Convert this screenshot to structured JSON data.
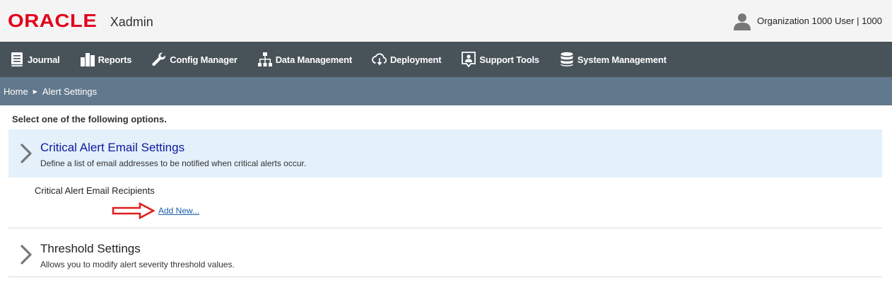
{
  "header": {
    "logo": "ORACLE",
    "app_name": "Xadmin",
    "user": "Organization 1000 User | 1000"
  },
  "nav": [
    {
      "label": "Journal",
      "icon": "journal-icon"
    },
    {
      "label": "Reports",
      "icon": "reports-icon"
    },
    {
      "label": "Config Manager",
      "icon": "wrench-icon"
    },
    {
      "label": "Data Management",
      "icon": "hierarchy-icon"
    },
    {
      "label": "Deployment",
      "icon": "cloud-download-icon"
    },
    {
      "label": "Support Tools",
      "icon": "support-icon"
    },
    {
      "label": "System Management",
      "icon": "database-icon"
    }
  ],
  "breadcrumb": {
    "home": "Home",
    "current": "Alert Settings"
  },
  "main": {
    "instructions": "Select one of the following options.",
    "sections": [
      {
        "title": "Critical Alert Email Settings",
        "description": "Define a list of email addresses to be notified when critical alerts occur.",
        "recipients_label": "Critical Alert Email Recipients",
        "add_link": "Add New..."
      },
      {
        "title": "Threshold Settings",
        "description": "Allows you to modify alert severity threshold values."
      }
    ]
  },
  "colors": {
    "logo": "#e2001a",
    "nav_bg": "#485259",
    "breadcrumb_bg": "#62788c",
    "active_section_bg": "#e4f0fa",
    "link": "#1a5ea8",
    "annotation_arrow": "#e01e1e"
  }
}
